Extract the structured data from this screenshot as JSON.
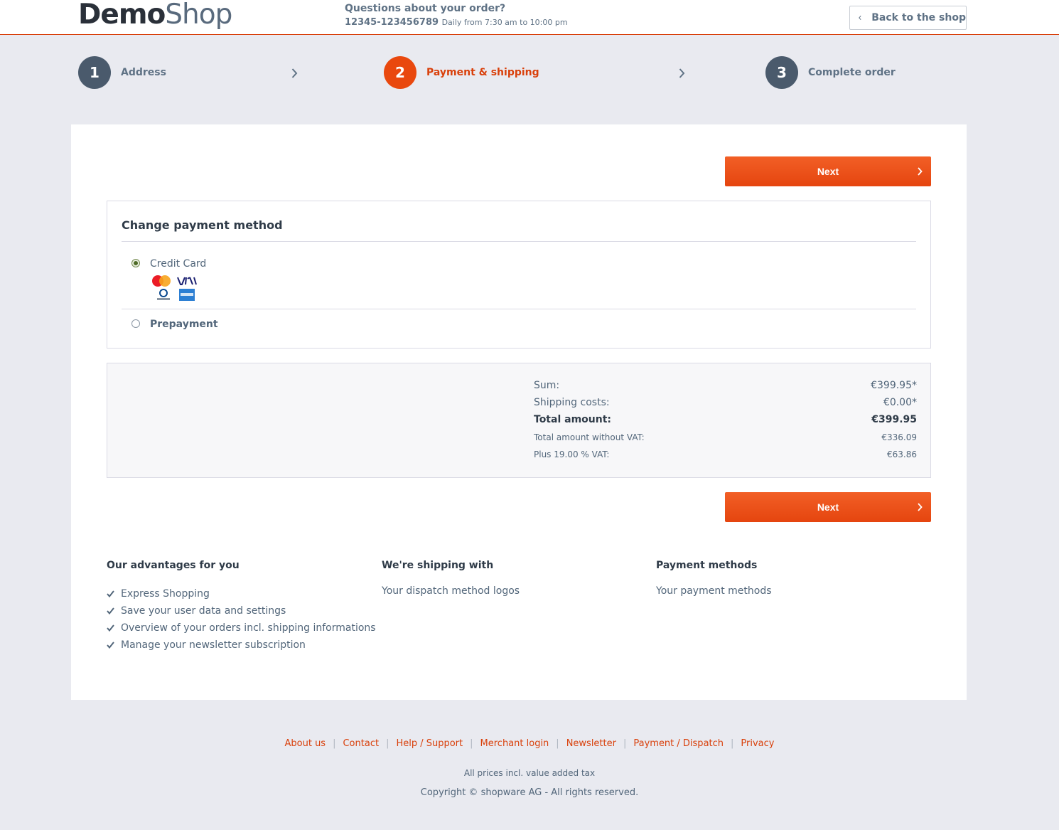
{
  "header": {
    "logo_part1": "Demo",
    "logo_part2": "Shop",
    "hotline_question": "Questions about your order?",
    "hotline_number": "12345-123456789",
    "hotline_hours": "Daily from 7:30 am to 10:00 pm",
    "back_label": "Back to the shop"
  },
  "steps": [
    {
      "number": "1",
      "label": "Address",
      "active": false
    },
    {
      "number": "2",
      "label": "Payment & shipping",
      "active": true
    },
    {
      "number": "3",
      "label": "Complete order",
      "active": false
    }
  ],
  "next_label": "Next",
  "payment": {
    "title": "Change payment method",
    "methods": [
      {
        "label": "Credit Card",
        "selected": true
      },
      {
        "label": "Prepayment",
        "selected": false
      }
    ]
  },
  "summary": {
    "sum_label": "Sum:",
    "sum_value": "€399.95*",
    "shipping_label": "Shipping costs:",
    "shipping_value": "€0.00*",
    "total_label": "Total amount:",
    "total_value": "€399.95",
    "net_label": "Total amount without VAT:",
    "net_value": "€336.09",
    "vat_label": "Plus 19.00 % VAT:",
    "vat_value": "€63.86"
  },
  "advantages": {
    "title": "Our advantages for you",
    "items": [
      "Express Shopping",
      "Save your user data and settings",
      "Overview of your orders incl. shipping informations",
      "Manage your newsletter subscription"
    ]
  },
  "shipping": {
    "title": "We're shipping with",
    "text": "Your dispatch method logos"
  },
  "payment_methods": {
    "title": "Payment methods",
    "text": "Your payment methods"
  },
  "footer": {
    "links": [
      "About us",
      "Contact",
      "Help / Support",
      "Merchant login",
      "Newsletter",
      "Payment / Dispatch",
      "Privacy"
    ],
    "vat_note": "All prices incl. value added tax",
    "copyright": "Copyright © shopware AG - All rights reserved."
  },
  "colors": {
    "accent": "#e9480e",
    "link": "#d9400b",
    "text": "#52667a",
    "background": "#e9eaf0"
  }
}
